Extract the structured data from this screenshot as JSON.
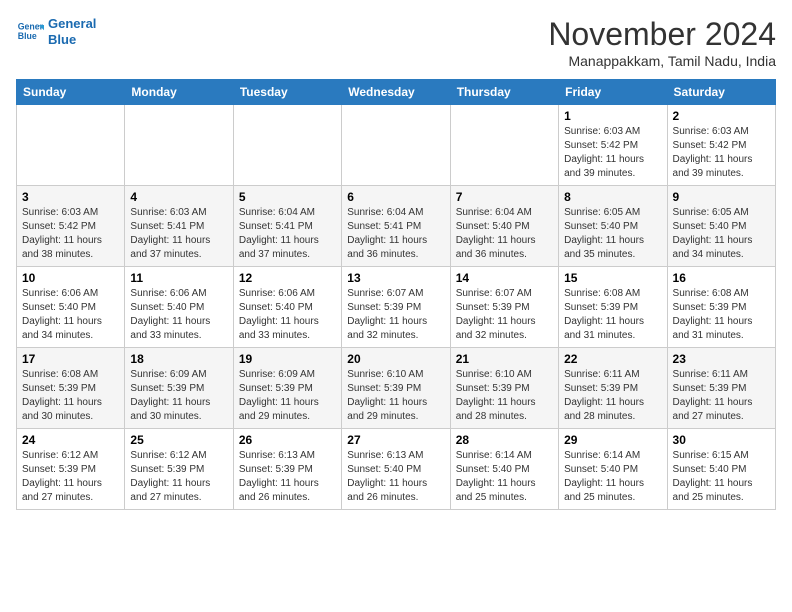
{
  "header": {
    "logo_line1": "General",
    "logo_line2": "Blue",
    "month": "November 2024",
    "location": "Manappakkam, Tamil Nadu, India"
  },
  "weekdays": [
    "Sunday",
    "Monday",
    "Tuesday",
    "Wednesday",
    "Thursday",
    "Friday",
    "Saturday"
  ],
  "weeks": [
    [
      {
        "day": "",
        "info": ""
      },
      {
        "day": "",
        "info": ""
      },
      {
        "day": "",
        "info": ""
      },
      {
        "day": "",
        "info": ""
      },
      {
        "day": "",
        "info": ""
      },
      {
        "day": "1",
        "info": "Sunrise: 6:03 AM\nSunset: 5:42 PM\nDaylight: 11 hours\nand 39 minutes."
      },
      {
        "day": "2",
        "info": "Sunrise: 6:03 AM\nSunset: 5:42 PM\nDaylight: 11 hours\nand 39 minutes."
      }
    ],
    [
      {
        "day": "3",
        "info": "Sunrise: 6:03 AM\nSunset: 5:42 PM\nDaylight: 11 hours\nand 38 minutes."
      },
      {
        "day": "4",
        "info": "Sunrise: 6:03 AM\nSunset: 5:41 PM\nDaylight: 11 hours\nand 37 minutes."
      },
      {
        "day": "5",
        "info": "Sunrise: 6:04 AM\nSunset: 5:41 PM\nDaylight: 11 hours\nand 37 minutes."
      },
      {
        "day": "6",
        "info": "Sunrise: 6:04 AM\nSunset: 5:41 PM\nDaylight: 11 hours\nand 36 minutes."
      },
      {
        "day": "7",
        "info": "Sunrise: 6:04 AM\nSunset: 5:40 PM\nDaylight: 11 hours\nand 36 minutes."
      },
      {
        "day": "8",
        "info": "Sunrise: 6:05 AM\nSunset: 5:40 PM\nDaylight: 11 hours\nand 35 minutes."
      },
      {
        "day": "9",
        "info": "Sunrise: 6:05 AM\nSunset: 5:40 PM\nDaylight: 11 hours\nand 34 minutes."
      }
    ],
    [
      {
        "day": "10",
        "info": "Sunrise: 6:06 AM\nSunset: 5:40 PM\nDaylight: 11 hours\nand 34 minutes."
      },
      {
        "day": "11",
        "info": "Sunrise: 6:06 AM\nSunset: 5:40 PM\nDaylight: 11 hours\nand 33 minutes."
      },
      {
        "day": "12",
        "info": "Sunrise: 6:06 AM\nSunset: 5:40 PM\nDaylight: 11 hours\nand 33 minutes."
      },
      {
        "day": "13",
        "info": "Sunrise: 6:07 AM\nSunset: 5:39 PM\nDaylight: 11 hours\nand 32 minutes."
      },
      {
        "day": "14",
        "info": "Sunrise: 6:07 AM\nSunset: 5:39 PM\nDaylight: 11 hours\nand 32 minutes."
      },
      {
        "day": "15",
        "info": "Sunrise: 6:08 AM\nSunset: 5:39 PM\nDaylight: 11 hours\nand 31 minutes."
      },
      {
        "day": "16",
        "info": "Sunrise: 6:08 AM\nSunset: 5:39 PM\nDaylight: 11 hours\nand 31 minutes."
      }
    ],
    [
      {
        "day": "17",
        "info": "Sunrise: 6:08 AM\nSunset: 5:39 PM\nDaylight: 11 hours\nand 30 minutes."
      },
      {
        "day": "18",
        "info": "Sunrise: 6:09 AM\nSunset: 5:39 PM\nDaylight: 11 hours\nand 30 minutes."
      },
      {
        "day": "19",
        "info": "Sunrise: 6:09 AM\nSunset: 5:39 PM\nDaylight: 11 hours\nand 29 minutes."
      },
      {
        "day": "20",
        "info": "Sunrise: 6:10 AM\nSunset: 5:39 PM\nDaylight: 11 hours\nand 29 minutes."
      },
      {
        "day": "21",
        "info": "Sunrise: 6:10 AM\nSunset: 5:39 PM\nDaylight: 11 hours\nand 28 minutes."
      },
      {
        "day": "22",
        "info": "Sunrise: 6:11 AM\nSunset: 5:39 PM\nDaylight: 11 hours\nand 28 minutes."
      },
      {
        "day": "23",
        "info": "Sunrise: 6:11 AM\nSunset: 5:39 PM\nDaylight: 11 hours\nand 27 minutes."
      }
    ],
    [
      {
        "day": "24",
        "info": "Sunrise: 6:12 AM\nSunset: 5:39 PM\nDaylight: 11 hours\nand 27 minutes."
      },
      {
        "day": "25",
        "info": "Sunrise: 6:12 AM\nSunset: 5:39 PM\nDaylight: 11 hours\nand 27 minutes."
      },
      {
        "day": "26",
        "info": "Sunrise: 6:13 AM\nSunset: 5:39 PM\nDaylight: 11 hours\nand 26 minutes."
      },
      {
        "day": "27",
        "info": "Sunrise: 6:13 AM\nSunset: 5:40 PM\nDaylight: 11 hours\nand 26 minutes."
      },
      {
        "day": "28",
        "info": "Sunrise: 6:14 AM\nSunset: 5:40 PM\nDaylight: 11 hours\nand 25 minutes."
      },
      {
        "day": "29",
        "info": "Sunrise: 6:14 AM\nSunset: 5:40 PM\nDaylight: 11 hours\nand 25 minutes."
      },
      {
        "day": "30",
        "info": "Sunrise: 6:15 AM\nSunset: 5:40 PM\nDaylight: 11 hours\nand 25 minutes."
      }
    ]
  ]
}
